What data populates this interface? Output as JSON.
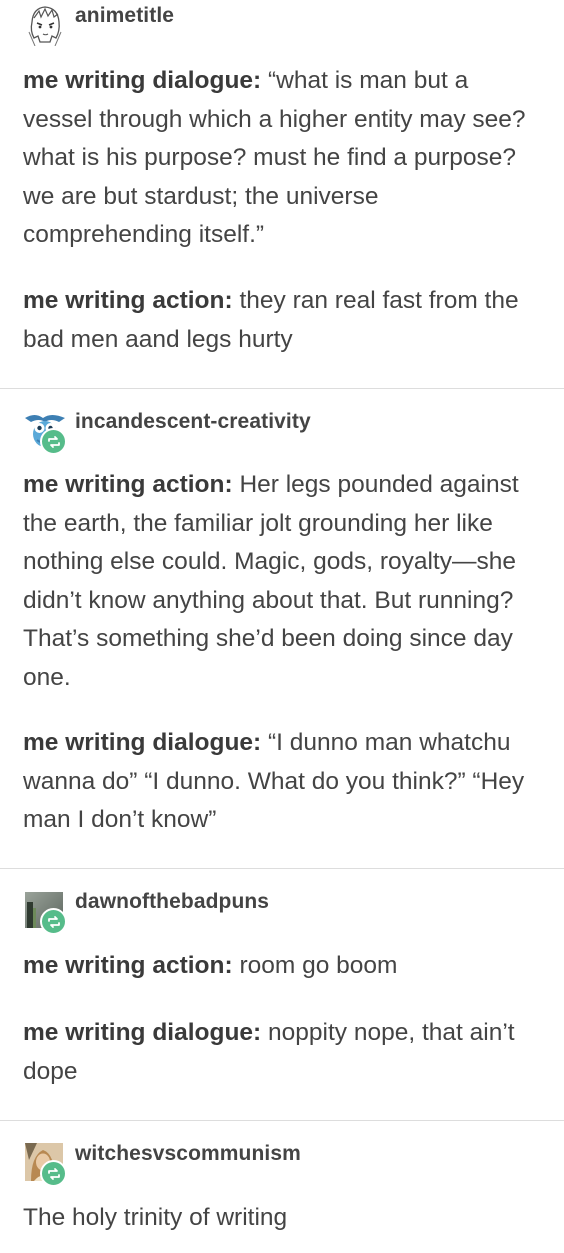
{
  "posts": [
    {
      "username": "animetitle",
      "avatar_icon": "anime-sketch-avatar",
      "reblogged": false,
      "paragraphs": [
        {
          "label": "me writing dialogue:",
          "text": " “what is man but a vessel through which a higher entity may see? what is his purpose? must he find a purpose? we are but stardust; the universe comprehending itself.”"
        },
        {
          "label": "me writing action:",
          "text": " they ran real fast from the bad men aand legs hurty"
        }
      ]
    },
    {
      "username": "incandescent-creativity",
      "avatar_icon": "blue-owl-avatar",
      "reblogged": true,
      "paragraphs": [
        {
          "label": "me writing action:",
          "text": " Her legs pounded against the earth, the familiar jolt grounding her like nothing else could. Magic, gods, royalty—she didn’t know anything about that. But running? That’s something she’d been doing since day one."
        },
        {
          "label": "me writing dialogue:",
          "text": " “I dunno man whatchu wanna do” “I dunno. What do you think?” “Hey man I don’t know”"
        }
      ]
    },
    {
      "username": "dawnofthebadpuns",
      "avatar_icon": "photo-avatar",
      "reblogged": true,
      "paragraphs": [
        {
          "label": "me writing action:",
          "text": " room go boom"
        },
        {
          "label": "me writing dialogue:",
          "text": " noppity nope, that ain’t dope"
        }
      ]
    },
    {
      "username": "witchesvscommunism",
      "avatar_icon": "person-photo-avatar",
      "reblogged": true,
      "paragraphs": [
        {
          "label": "",
          "text": "The holy trinity of writing"
        }
      ]
    }
  ],
  "colors": {
    "text": "#444444",
    "reblog_badge": "#56bc8a",
    "divider": "#dddddd"
  }
}
